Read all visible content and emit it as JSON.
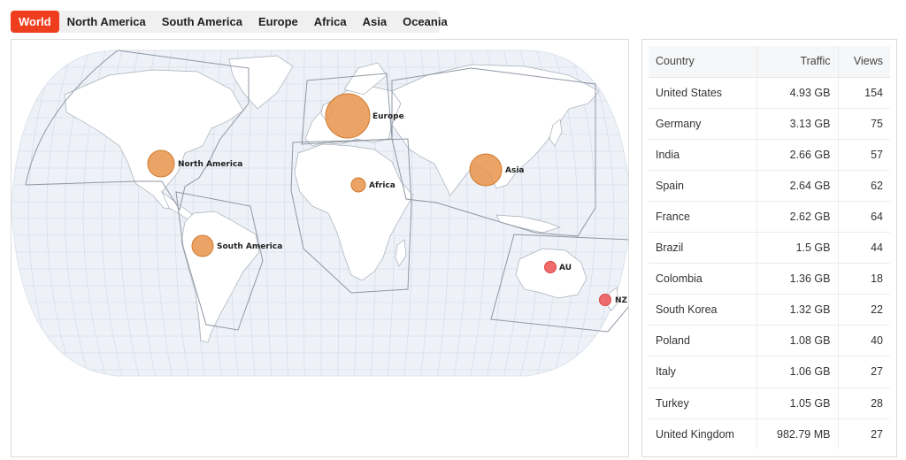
{
  "tabs": [
    {
      "label": "World",
      "active": true
    },
    {
      "label": "North America",
      "active": false
    },
    {
      "label": "South America",
      "active": false
    },
    {
      "label": "Europe",
      "active": false
    },
    {
      "label": "Africa",
      "active": false
    },
    {
      "label": "Asia",
      "active": false
    },
    {
      "label": "Oceania",
      "active": false
    }
  ],
  "map": {
    "colors": {
      "ocean": "#eef2f8",
      "graticule": "#d7dee9",
      "land": "#ffffff",
      "border": "#9aa3ad",
      "region_outline": "#8e97a3",
      "bubble_region": "#e8944a",
      "bubble_country": "#ee5c5c"
    },
    "labels": {
      "north_america": "North America",
      "south_america": "South America",
      "europe": "Europe",
      "africa": "Africa",
      "asia": "Asia",
      "au": "AU",
      "nz": "NZ"
    }
  },
  "table": {
    "headers": {
      "country": "Country",
      "traffic": "Traffic",
      "views": "Views"
    },
    "rows": [
      {
        "country": "United States",
        "traffic": "4.93 GB",
        "views": "154"
      },
      {
        "country": "Germany",
        "traffic": "3.13 GB",
        "views": "75"
      },
      {
        "country": "India",
        "traffic": "2.66 GB",
        "views": "57"
      },
      {
        "country": "Spain",
        "traffic": "2.64 GB",
        "views": "62"
      },
      {
        "country": "France",
        "traffic": "2.62 GB",
        "views": "64"
      },
      {
        "country": "Brazil",
        "traffic": "1.5 GB",
        "views": "44"
      },
      {
        "country": "Colombia",
        "traffic": "1.36 GB",
        "views": "18"
      },
      {
        "country": "South Korea",
        "traffic": "1.32 GB",
        "views": "22"
      },
      {
        "country": "Poland",
        "traffic": "1.08 GB",
        "views": "40"
      },
      {
        "country": "Italy",
        "traffic": "1.06 GB",
        "views": "27"
      },
      {
        "country": "Turkey",
        "traffic": "1.05 GB",
        "views": "28"
      },
      {
        "country": "United Kingdom",
        "traffic": "982.79 MB",
        "views": "27"
      }
    ]
  }
}
